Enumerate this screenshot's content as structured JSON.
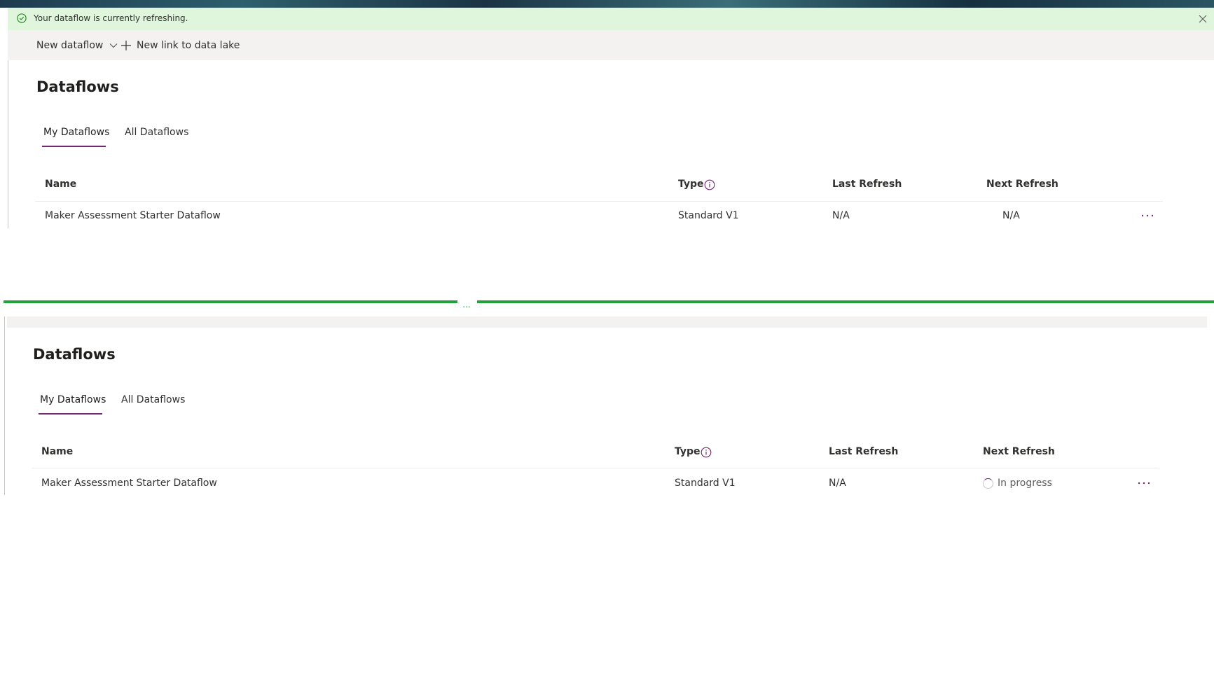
{
  "notification": {
    "text": "Your dataflow is currently refreshing.",
    "close_icon": "close-icon",
    "status_icon": "check-circle-icon"
  },
  "commandbar": {
    "new_dataflow": "New dataflow",
    "new_link": "New link to data lake"
  },
  "top": {
    "title": "Dataflows",
    "tabs": [
      "My Dataflows",
      "All Dataflows"
    ],
    "active_tab": "My Dataflows",
    "columns": [
      "Name",
      "Type",
      "Last Refresh",
      "Next Refresh"
    ],
    "row": {
      "name": "Maker Assessment Starter Dataflow",
      "type": "Standard V1",
      "last_refresh": "N/A",
      "next_refresh": "N/A"
    }
  },
  "divider": {
    "dots": "..."
  },
  "bottom": {
    "title": "Dataflows",
    "tabs": [
      "My Dataflows",
      "All Dataflows"
    ],
    "active_tab": "My Dataflows",
    "columns": [
      "Name",
      "Type",
      "Last Refresh",
      "Next Refresh"
    ],
    "row": {
      "name": "Maker Assessment Starter Dataflow",
      "type": "Standard V1",
      "last_refresh": "N/A",
      "next_refresh": "In progress"
    }
  },
  "colors": {
    "accent": "#742774",
    "success_bg": "#dff6dd",
    "divider": "#21a33a",
    "success_icon": "#107c10"
  }
}
